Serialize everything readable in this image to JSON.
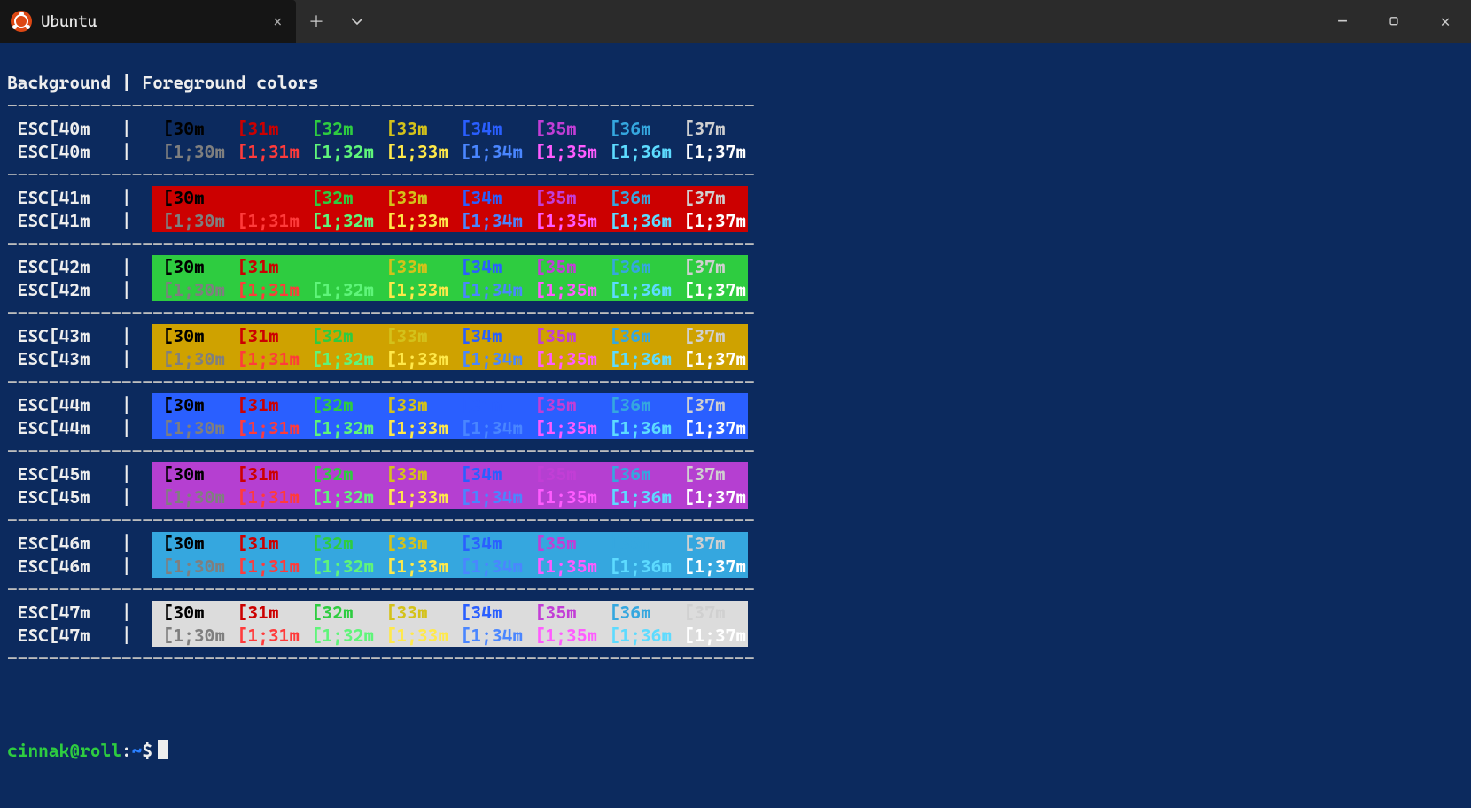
{
  "window": {
    "tab_title": "Ubuntu",
    "tab_close": "×",
    "new_tab": "＋",
    "dropdown": "⌄",
    "minimize": "—",
    "maximize": "▢",
    "close": "✕"
  },
  "header": {
    "bg_label": "Background",
    "pipe": " | ",
    "fg_label": "Foreground colors"
  },
  "separator": "------------------------------------------------------------------------",
  "prompt": {
    "user": "cinnak@roll",
    "sep": ":",
    "path": "~",
    "dollar": "$"
  },
  "colors": {
    "fg": {
      "30": "#000000",
      "31": "#cc0000",
      "32": "#2ecc40",
      "33": "#d4c21a",
      "34": "#2a5fff",
      "35": "#c23ed6",
      "36": "#35a7df",
      "37": "#d0d0d0",
      "1;30": "#7f7f7f",
      "1;31": "#ff3b3b",
      "1;32": "#5ff57a",
      "1;33": "#ffe94a",
      "1;34": "#4a86ff",
      "1;35": "#ff5cff",
      "1;36": "#5ddbff",
      "1;37": "#ffffff"
    },
    "bg": {
      "40": "#0c2a5e",
      "41": "#cc0000",
      "42": "#2ecc40",
      "43": "#cfa200",
      "44": "#2a5fff",
      "45": "#b53fd1",
      "46": "#35a7df",
      "47": "#dcdcdc"
    }
  },
  "bg_codes": [
    "40",
    "41",
    "42",
    "43",
    "44",
    "45",
    "46",
    "47"
  ],
  "fg_normal": [
    "30",
    "31",
    "32",
    "33",
    "34",
    "35",
    "36",
    "37"
  ],
  "fg_bright": [
    "1;30",
    "1;31",
    "1;32",
    "1;33",
    "1;34",
    "1;35",
    "1;36",
    "1;37"
  ]
}
